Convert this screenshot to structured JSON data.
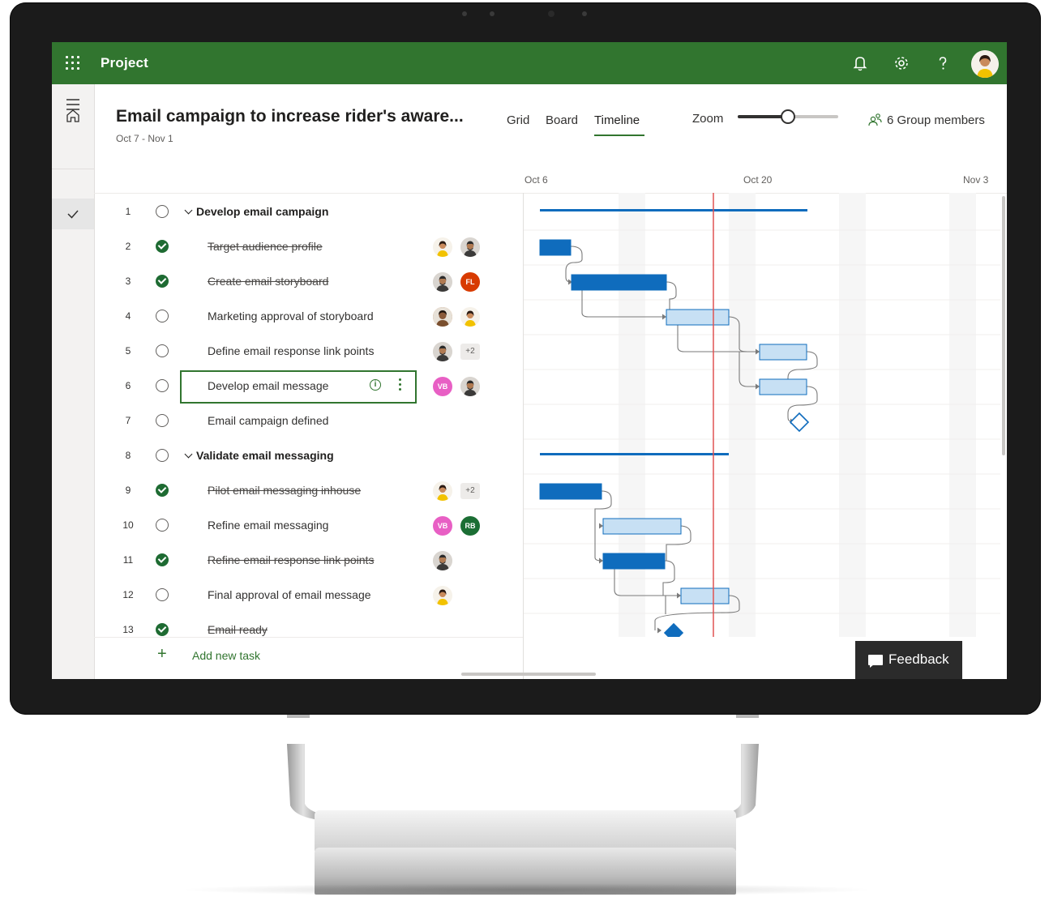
{
  "app": {
    "name": "Project"
  },
  "plan": {
    "title": "Email campaign to increase rider's aware...",
    "dates": "Oct 7 - Nov 1"
  },
  "views": {
    "grid": "Grid",
    "board": "Board",
    "timeline": "Timeline",
    "active": "Timeline"
  },
  "zoom": {
    "label": "Zoom",
    "level": 0.5
  },
  "members": {
    "label": "6 Group members"
  },
  "timeline_dates": [
    "Oct 6",
    "Oct 20",
    "Nov 3"
  ],
  "tasks": [
    {
      "num": "1",
      "name": "Develop email campaign",
      "summary": true,
      "done": false,
      "assignees": []
    },
    {
      "num": "2",
      "name": "Target audience profile",
      "summary": false,
      "done": true,
      "assignees": []
    },
    {
      "num": "3",
      "name": "Create email storyboard",
      "summary": false,
      "done": true,
      "assignees": [
        "FL"
      ]
    },
    {
      "num": "4",
      "name": "Marketing approval of storyboard",
      "summary": false,
      "done": false,
      "assignees": []
    },
    {
      "num": "5",
      "name": "Define email response link points",
      "summary": false,
      "done": false,
      "assignees": [
        "+2"
      ]
    },
    {
      "num": "6",
      "name": "Develop email message",
      "summary": false,
      "done": false,
      "assignees": [
        "VB"
      ],
      "selected": true
    },
    {
      "num": "7",
      "name": "Email campaign defined",
      "summary": false,
      "done": false,
      "assignees": []
    },
    {
      "num": "8",
      "name": "Validate email messaging",
      "summary": true,
      "done": false,
      "assignees": []
    },
    {
      "num": "9",
      "name": "Pilot email messaging inhouse",
      "summary": false,
      "done": true,
      "assignees": [
        "+2"
      ]
    },
    {
      "num": "10",
      "name": "Refine email messaging",
      "summary": false,
      "done": false,
      "assignees": [
        "VB",
        "RB"
      ]
    },
    {
      "num": "11",
      "name": "Refine email response link points",
      "summary": false,
      "done": true,
      "assignees": []
    },
    {
      "num": "12",
      "name": "Final approval of email message",
      "summary": false,
      "done": false,
      "assignees": []
    },
    {
      "num": "13",
      "name": "Email ready",
      "summary": false,
      "done": true,
      "assignees": []
    }
  ],
  "add_task": {
    "label": "Add new task"
  },
  "feedback": {
    "label": "Feedback"
  },
  "colors": {
    "brand": "#31752f",
    "bar_dark": "#0f6cbd",
    "bar_light": "#c7e0f4",
    "today_line": "#e05252"
  },
  "icons": {
    "topbar": [
      "waffle-icon",
      "bell-icon",
      "gear-icon",
      "help-icon"
    ],
    "rail": [
      "hamburger-icon",
      "home-icon",
      "check-icon"
    ]
  }
}
